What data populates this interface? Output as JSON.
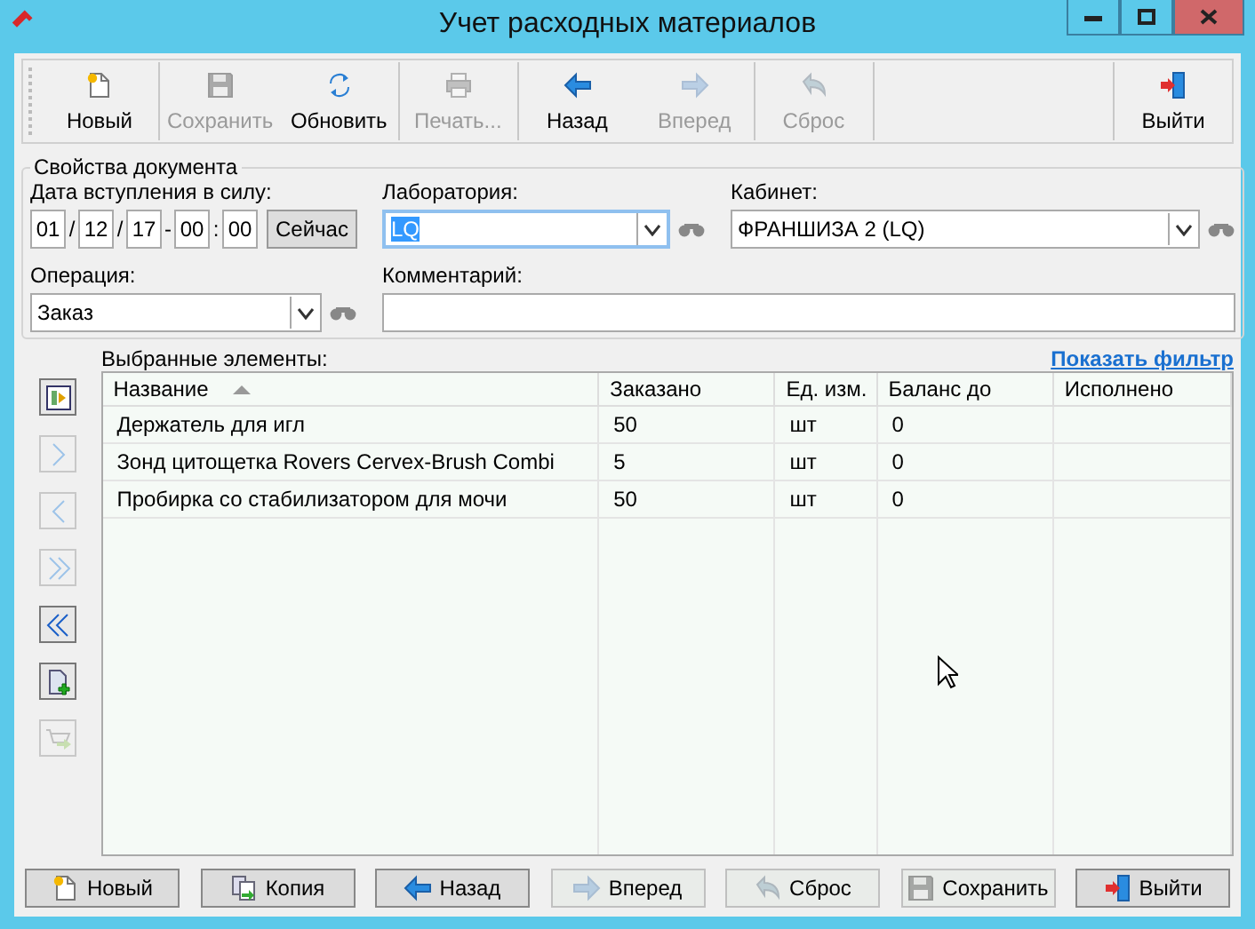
{
  "window": {
    "title": "Учет расходных материалов"
  },
  "toolbar": {
    "left_groups": [
      [
        {
          "label": "Новый",
          "disabled": false
        }
      ],
      [
        {
          "label": "Сохранить",
          "disabled": true
        },
        {
          "label": "Обновить",
          "disabled": false
        }
      ],
      [
        {
          "label": "Печать...",
          "disabled": true
        }
      ],
      [
        {
          "label": "Назад",
          "disabled": false
        },
        {
          "label": "Вперед",
          "disabled": true
        }
      ],
      [
        {
          "label": "Сброс",
          "disabled": true
        }
      ]
    ],
    "right_groups": [
      [
        {
          "label": "Выйти",
          "disabled": false
        }
      ]
    ]
  },
  "properties": {
    "title": "Свойства документа",
    "date": {
      "label": "Дата вступления в силу:",
      "fields": [
        {
          "value": "01",
          "after": "/"
        },
        {
          "value": "12",
          "after": "/"
        },
        {
          "value": "17",
          "after": "-"
        },
        {
          "value": "00",
          "after": ":"
        },
        {
          "value": "00"
        }
      ],
      "now_button": "Сейчас"
    },
    "laboratory": {
      "label": "Лаборатория:",
      "value": "LQ",
      "focused": true
    },
    "cabinet": {
      "label": "Кабинет:",
      "value": "ФРАНШИЗА 2 (LQ)",
      "focused": false
    },
    "operation": {
      "label": "Операция:",
      "value": "Заказ",
      "focused": false
    },
    "comment": {
      "label": "Комментарий:"
    }
  },
  "selected_items": {
    "label": "Выбранные элементы:",
    "filter_link": "Показать фильтр",
    "side_buttons": [
      {
        "disabled": false
      },
      {
        "disabled": true
      },
      {
        "disabled": true
      },
      {
        "disabled": true
      },
      {
        "disabled": false
      },
      {
        "disabled": false
      },
      {
        "disabled": true
      }
    ],
    "columns": [
      {
        "label": "Название",
        "sorted": true
      },
      {
        "label": "Заказано",
        "sorted": false
      },
      {
        "label": "Ед. изм.",
        "sorted": false
      },
      {
        "label": "Баланс до",
        "sorted": false
      },
      {
        "label": "Исполнено",
        "sorted": false
      }
    ],
    "rows": [
      [
        "Держатель для игл",
        "50",
        "шт",
        "0",
        ""
      ],
      [
        "Зонд цитощетка Rovers Cervex-Brush Combi",
        "5",
        "шт",
        "0",
        ""
      ],
      [
        "Пробирка со стабилизатором для мочи",
        "50",
        "шт",
        "0",
        ""
      ]
    ]
  },
  "bottom_buttons": [
    {
      "label": "Новый",
      "disabled": false
    },
    {
      "label": "Копия",
      "disabled": false
    },
    {
      "label": "Назад",
      "disabled": false
    },
    {
      "label": "Вперед",
      "disabled": true
    },
    {
      "label": "Сброс",
      "disabled": true
    },
    {
      "label": "Сохранить",
      "disabled": true
    },
    {
      "label": "Выйти",
      "disabled": false
    }
  ]
}
